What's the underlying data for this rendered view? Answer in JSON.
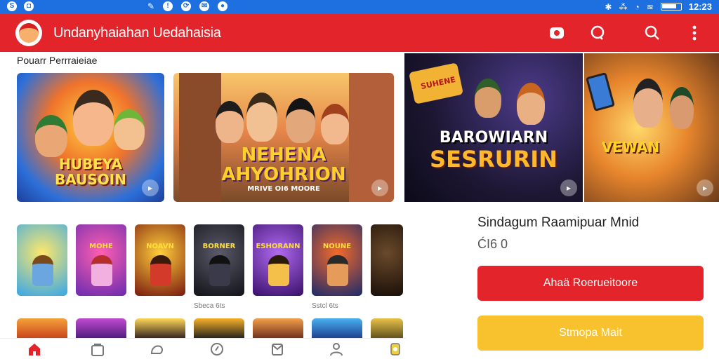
{
  "status_bar": {
    "time": "12:23"
  },
  "app": {
    "title": "Undanyhaiahan Uedahaisia"
  },
  "section": {
    "title": "Pouarr Perrraieiae"
  },
  "banners": [
    {
      "title_line1": "HUBEYA",
      "title_line2": "BAUSOIN"
    },
    {
      "title_line1": "NEHENA",
      "title_line2": "AHYOHRION",
      "subtitle": "MRIVE OI6 MOORE"
    },
    {
      "badge": "SUHENE",
      "title_line1": "BAROWIARN",
      "title_line2": "SESRURIN"
    },
    {
      "title_line1": "VEWAN"
    }
  ],
  "tiles": [
    {
      "title": ""
    },
    {
      "title": "MOHE"
    },
    {
      "title": "NOAVN"
    },
    {
      "title": "BORNER"
    },
    {
      "title": "ESHORANN"
    },
    {
      "title": "NOUNE"
    },
    {
      "title": ""
    }
  ],
  "tile_captions": [
    "Sbeca 6ts",
    "Sstcl 6ts"
  ],
  "info": {
    "title": "Sindagum Raamipuar Mnid",
    "meta": "ĆI6 0",
    "primary_button": "Ahaä Roerueitoore",
    "secondary_button": "Stmopa Mait"
  },
  "bottom_nav": [
    "home-icon",
    "store-icon",
    "chat-icon",
    "explore-icon",
    "inbox-icon",
    "profile-icon",
    "games-icon"
  ],
  "colors": {
    "accent": "#e3242b",
    "status_bar": "#1e6fe0",
    "secondary": "#f8c22e"
  }
}
